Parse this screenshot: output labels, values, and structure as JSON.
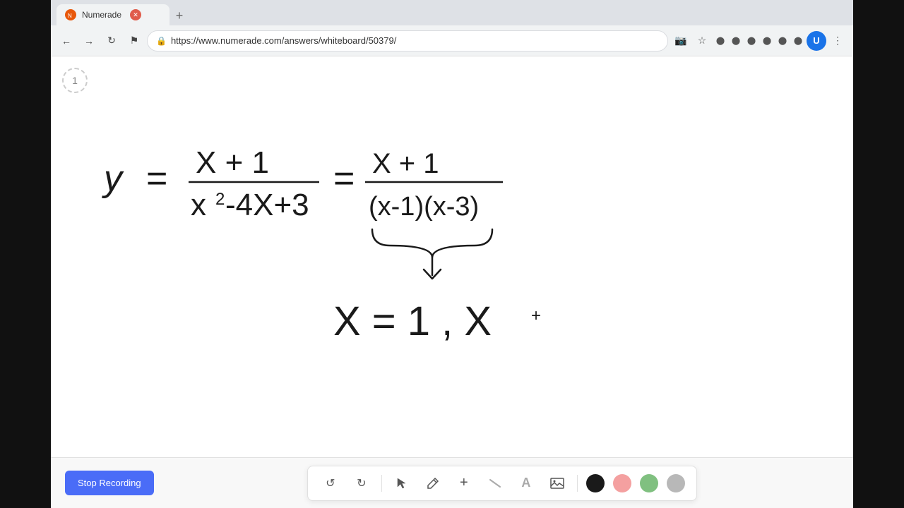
{
  "browser": {
    "tab_title": "Numerade",
    "url": "https://www.numerade.com/answers/whiteboard/50379/",
    "new_tab_label": "+",
    "page_number": "1"
  },
  "toolbar": {
    "stop_recording_label": "Stop Recording",
    "undo_icon": "↺",
    "redo_icon": "↻",
    "select_icon": "▲",
    "pen_icon": "✏",
    "plus_icon": "+",
    "eraser_icon": "/",
    "text_icon": "A",
    "image_icon": "▣",
    "color_black": "#1a1a1a",
    "color_pink": "#f4a0a0",
    "color_green": "#80c080",
    "color_gray": "#b0b0b0"
  }
}
